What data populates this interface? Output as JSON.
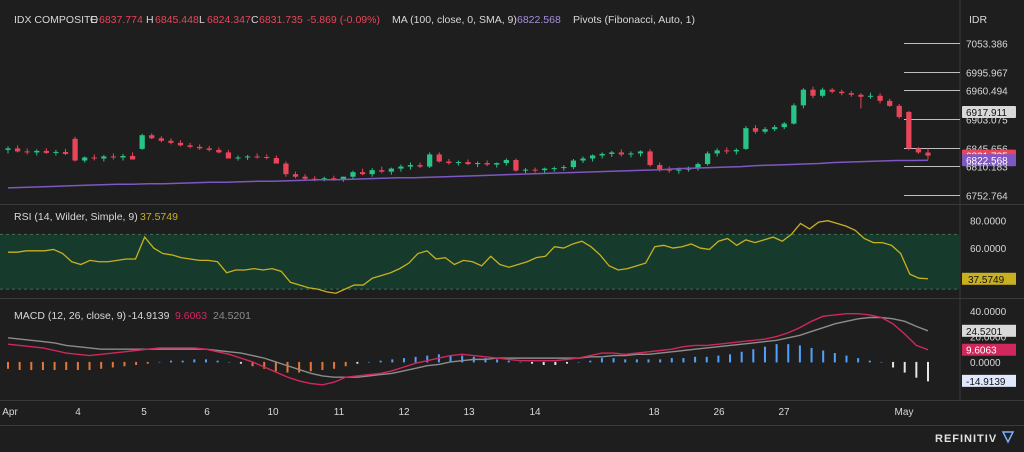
{
  "colors": {
    "background": "#1e1e1e",
    "panel_border": "#3a3a3a",
    "up": "#26c486",
    "down": "#e8455a",
    "ma": "#7e57c2",
    "rsi_line": "#c9b021",
    "rsi_band": "#163a2b",
    "macd_line": "#d0285c",
    "signal_line": "#8c8c8c",
    "hist_pos": "#4fa3ff",
    "hist_neg": "#e6e6e6",
    "hist_orange": "#e07a3a",
    "text": "#d8d8d8"
  },
  "header": {
    "symbol": "IDX COMPOSITE",
    "o_label": "O",
    "o_value": "6837.774",
    "h_label": "H",
    "h_value": "6845.448",
    "l_label": "L",
    "l_value": "6824.347",
    "c_label": "C",
    "c_value": "6831.735",
    "change": "-5.869 (-0.09%)",
    "ma_label": "MA (100, close, 0, SMA, 9)",
    "ma_value": "6822.568",
    "pivots_label": "Pivots (Fibonacci, Auto, 1)"
  },
  "currency": "IDR",
  "brand": "REFINITIV",
  "x_tick_labels": [
    "Apr",
    "4",
    "5",
    "6",
    "10",
    "11",
    "12",
    "13",
    "14",
    "18",
    "26",
    "27",
    "May"
  ],
  "chart_data": [
    {
      "type": "candlestick",
      "panel": "price",
      "ylim": [
        6740,
        7080
      ],
      "y_tick_labels": [
        "7053.386",
        "6995.967",
        "6960.494",
        "6917.911",
        "6903.075",
        "6845.656",
        "6831.735",
        "6822.568",
        "6810.183",
        "6752.764"
      ],
      "price_badges": [
        {
          "label": "6917.911",
          "style": "light"
        },
        {
          "label": "6831.735",
          "style": "down"
        },
        {
          "label": "6822.568",
          "style": "ma"
        }
      ],
      "pivot_levels": [
        7053.386,
        6995.967,
        6960.494,
        6903.075,
        6845.656,
        6810.183,
        6752.764
      ],
      "candles": [
        [
          6843,
          6850,
          6836,
          6846
        ],
        [
          6846,
          6852,
          6838,
          6840
        ],
        [
          6840,
          6846,
          6834,
          6838
        ],
        [
          6838,
          6844,
          6832,
          6841
        ],
        [
          6841,
          6846,
          6835,
          6837
        ],
        [
          6837,
          6843,
          6832,
          6839
        ],
        [
          6839,
          6845,
          6833,
          6835
        ],
        [
          6865,
          6869,
          6820,
          6822
        ],
        [
          6822,
          6830,
          6818,
          6828
        ],
        [
          6828,
          6834,
          6822,
          6826
        ],
        [
          6826,
          6833,
          6820,
          6830
        ],
        [
          6830,
          6836,
          6824,
          6828
        ],
        [
          6828,
          6835,
          6822,
          6831
        ],
        [
          6831,
          6838,
          6826,
          6824
        ],
        [
          6845,
          6875,
          6843,
          6872
        ],
        [
          6872,
          6876,
          6864,
          6866
        ],
        [
          6866,
          6870,
          6858,
          6861
        ],
        [
          6861,
          6866,
          6854,
          6857
        ],
        [
          6857,
          6862,
          6850,
          6852
        ],
        [
          6852,
          6857,
          6846,
          6849
        ],
        [
          6849,
          6854,
          6843,
          6846
        ],
        [
          6846,
          6851,
          6840,
          6843
        ],
        [
          6843,
          6848,
          6836,
          6838
        ],
        [
          6838,
          6843,
          6830,
          6826
        ],
        [
          6826,
          6832,
          6822,
          6828
        ],
        [
          6828,
          6833,
          6823,
          6830
        ],
        [
          6830,
          6836,
          6826,
          6829
        ],
        [
          6829,
          6834,
          6824,
          6827
        ],
        [
          6827,
          6832,
          6820,
          6816
        ],
        [
          6816,
          6820,
          6790,
          6795
        ],
        [
          6795,
          6800,
          6787,
          6790
        ],
        [
          6790,
          6795,
          6783,
          6786
        ],
        [
          6786,
          6791,
          6781,
          6784
        ],
        [
          6784,
          6790,
          6781,
          6787
        ],
        [
          6787,
          6792,
          6782,
          6785
        ],
        [
          6785,
          6790,
          6780,
          6790
        ],
        [
          6790,
          6802,
          6786,
          6799
        ],
        [
          6799,
          6806,
          6793,
          6795
        ],
        [
          6795,
          6807,
          6790,
          6803
        ],
        [
          6803,
          6810,
          6797,
          6800
        ],
        [
          6800,
          6808,
          6794,
          6806
        ],
        [
          6806,
          6814,
          6800,
          6810
        ],
        [
          6810,
          6818,
          6804,
          6813
        ],
        [
          6813,
          6818,
          6807,
          6810
        ],
        [
          6810,
          6838,
          6807,
          6834
        ],
        [
          6834,
          6838,
          6818,
          6820
        ],
        [
          6820,
          6825,
          6814,
          6817
        ],
        [
          6817,
          6822,
          6812,
          6819
        ],
        [
          6819,
          6824,
          6813,
          6815
        ],
        [
          6815,
          6820,
          6809,
          6817
        ],
        [
          6817,
          6822,
          6811,
          6814
        ],
        [
          6814,
          6818,
          6808,
          6817
        ],
        [
          6817,
          6826,
          6812,
          6823
        ],
        [
          6823,
          6826,
          6800,
          6802
        ],
        [
          6802,
          6807,
          6797,
          6804
        ],
        [
          6804,
          6808,
          6798,
          6803
        ],
        [
          6803,
          6808,
          6797,
          6806
        ],
        [
          6806,
          6810,
          6800,
          6807
        ],
        [
          6807,
          6813,
          6802,
          6809
        ],
        [
          6809,
          6825,
          6805,
          6822
        ],
        [
          6822,
          6830,
          6817,
          6826
        ],
        [
          6826,
          6834,
          6820,
          6832
        ],
        [
          6832,
          6838,
          6826,
          6835
        ],
        [
          6835,
          6841,
          6829,
          6838
        ],
        [
          6838,
          6844,
          6830,
          6834
        ],
        [
          6834,
          6840,
          6828,
          6836
        ],
        [
          6836,
          6842,
          6830,
          6840
        ],
        [
          6840,
          6844,
          6810,
          6813
        ],
        [
          6813,
          6818,
          6800,
          6805
        ],
        [
          6805,
          6810,
          6798,
          6802
        ],
        [
          6802,
          6808,
          6796,
          6804
        ],
        [
          6804,
          6810,
          6800,
          6808
        ],
        [
          6808,
          6818,
          6802,
          6815
        ],
        [
          6815,
          6840,
          6812,
          6836
        ],
        [
          6836,
          6846,
          6830,
          6842
        ],
        [
          6842,
          6848,
          6835,
          6840
        ],
        [
          6840,
          6846,
          6834,
          6843
        ],
        [
          6845,
          6890,
          6843,
          6886
        ],
        [
          6886,
          6892,
          6875,
          6879
        ],
        [
          6879,
          6888,
          6875,
          6884
        ],
        [
          6884,
          6892,
          6880,
          6888
        ],
        [
          6888,
          6898,
          6884,
          6895
        ],
        [
          6895,
          6935,
          6893,
          6931
        ],
        [
          6931,
          6965,
          6925,
          6962
        ],
        [
          6962,
          6968,
          6945,
          6950
        ],
        [
          6950,
          6966,
          6947,
          6962
        ],
        [
          6962,
          6965,
          6955,
          6958
        ],
        [
          6958,
          6962,
          6951,
          6955
        ],
        [
          6955,
          6959,
          6948,
          6952
        ],
        [
          6952,
          6955,
          6925,
          6948
        ],
        [
          6948,
          6956,
          6944,
          6950
        ],
        [
          6950,
          6955,
          6935,
          6940
        ],
        [
          6940,
          6944,
          6928,
          6930
        ],
        [
          6930,
          6934,
          6905,
          6908
        ],
        [
          6918,
          6920,
          6842,
          6846
        ],
        [
          6846,
          6849,
          6835,
          6838
        ],
        [
          6837.774,
          6845.448,
          6824.347,
          6831.735
        ]
      ],
      "ma": [
        6768,
        6769,
        6770,
        6771,
        6772,
        6773,
        6774,
        6775,
        6775,
        6776,
        6776,
        6777,
        6778,
        6779,
        6779,
        6780,
        6781,
        6781,
        6782,
        6783,
        6784,
        6784,
        6785,
        6786,
        6787,
        6788,
        6788,
        6789,
        6790,
        6791,
        6792,
        6793,
        6794,
        6795,
        6796,
        6797,
        6798,
        6799,
        6800,
        6801,
        6802,
        6803,
        6804,
        6806,
        6807,
        6808,
        6809,
        6810,
        6812,
        6813,
        6814,
        6815,
        6816,
        6818,
        6819,
        6820,
        6821,
        6822,
        6822,
        6822.568
      ]
    },
    {
      "type": "line",
      "panel": "rsi",
      "title": "RSI (14, Wilder, Simple, 9)",
      "last_value": "37.5749",
      "ylim": [
        25,
        90
      ],
      "y_tick_labels": [
        "80.0000",
        "60.0000"
      ],
      "band": [
        30,
        70
      ],
      "values": [
        57,
        57,
        58,
        58,
        58,
        59,
        56,
        50,
        48,
        51,
        50,
        50,
        51,
        52,
        52,
        68,
        60,
        56,
        55,
        53,
        52,
        51,
        51,
        50,
        42,
        44,
        44,
        45,
        44,
        45,
        43,
        35,
        33,
        31,
        30,
        28,
        27,
        30,
        33,
        33,
        38,
        40,
        42,
        45,
        49,
        56,
        58,
        52,
        53,
        48,
        51,
        50,
        47,
        54,
        48,
        46,
        48,
        50,
        53,
        54,
        61,
        60,
        63,
        65,
        61,
        55,
        47,
        44,
        45,
        47,
        49,
        61,
        62,
        60,
        61,
        63,
        60,
        59,
        65,
        67,
        62,
        66,
        64,
        66,
        68,
        65,
        70,
        78,
        74,
        79,
        80,
        78,
        76,
        73,
        67,
        64,
        64,
        62,
        56,
        41,
        38,
        37.5749
      ]
    },
    {
      "type": "line",
      "panel": "macd",
      "title": "MACD (12, 26, close, 9)",
      "macd_value": "-14.9139",
      "signal_value": "9.6063",
      "hist_value": "24.5201",
      "ylim": [
        -30,
        48
      ],
      "y_tick_labels": [
        "40.0000",
        "20.0000",
        "0.0000"
      ],
      "macd": [
        14,
        13,
        12,
        11,
        9,
        7,
        6,
        5,
        6,
        7,
        8,
        9,
        10,
        11,
        11,
        11,
        11,
        10,
        8,
        6,
        3,
        0,
        -4,
        -8,
        -12,
        -15,
        -17,
        -18,
        -16,
        -12,
        -11,
        -10,
        -9,
        -7,
        -4,
        -1,
        1,
        3,
        5,
        6,
        5,
        4,
        3,
        2,
        1,
        1,
        1,
        1,
        2,
        3,
        5,
        7,
        7,
        6,
        7,
        8,
        9,
        10,
        12,
        13,
        13,
        14,
        15,
        16,
        17,
        18,
        20,
        23,
        27,
        32,
        36,
        37,
        38,
        38,
        37,
        35,
        30,
        22,
        13,
        9.6063
      ],
      "signal": [
        19,
        18,
        17,
        16,
        15,
        13,
        12,
        11,
        10,
        10,
        10,
        10,
        10,
        10,
        10,
        10,
        10,
        10,
        9,
        8,
        7,
        5,
        3,
        0,
        -3,
        -6,
        -9,
        -11,
        -12,
        -12,
        -12,
        -11,
        -10,
        -9,
        -7,
        -5,
        -3,
        -2,
        0,
        1,
        2,
        2,
        3,
        3,
        3,
        3,
        3,
        3,
        3,
        3,
        4,
        4,
        5,
        5,
        6,
        6,
        7,
        8,
        9,
        10,
        11,
        12,
        13,
        14,
        15,
        16,
        17,
        19,
        21,
        24,
        27,
        30,
        32,
        34,
        35,
        35,
        34,
        32,
        28,
        24.5201
      ],
      "histogram": [
        -5,
        -6,
        -6,
        -6,
        -6,
        -6,
        -6,
        -6,
        -5,
        -4,
        -3,
        -2,
        -1,
        0,
        1,
        1,
        2,
        2,
        1,
        0,
        -1,
        -3,
        -5,
        -7,
        -8,
        -8,
        -7,
        -6,
        -5,
        -3,
        -1,
        0,
        1,
        2,
        3,
        4,
        5,
        6,
        5,
        5,
        4,
        3,
        2,
        1,
        0,
        -1,
        -2,
        -2,
        -1,
        0,
        1,
        3,
        3,
        2,
        2,
        2,
        2,
        3,
        3,
        4,
        4,
        5,
        6,
        8,
        10,
        12,
        14,
        14,
        13,
        11,
        9,
        7,
        5,
        3,
        1,
        0,
        -4,
        -8,
        -12,
        -14.9139
      ]
    }
  ]
}
